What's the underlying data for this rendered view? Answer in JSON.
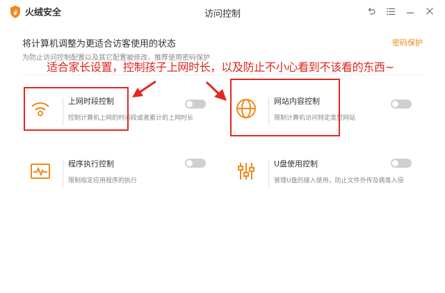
{
  "app": {
    "name": "火绒安全",
    "window_title": "访问控制"
  },
  "window_controls": [
    {
      "name": "back-icon",
      "glyph": "↶"
    },
    {
      "name": "menu-icon",
      "glyph": "☰"
    },
    {
      "name": "minimize-icon",
      "glyph": "—"
    },
    {
      "name": "close-icon",
      "glyph": "✕"
    }
  ],
  "header": {
    "headline": "将计算机调整为更适合访客使用的状态",
    "password_link": "密码保护",
    "subline": "为防止访问控制配置以及其它配置被修改，推荐使用密码保护"
  },
  "annotation": "适合家长设置，控制孩子上网时长，以及防止不小心看到不该看的东西~",
  "features": [
    {
      "title": "上网时段控制",
      "description": "控制计算机上网的时间段或者累计的上网时长",
      "icon": "wifi-icon",
      "enabled": false
    },
    {
      "title": "网站内容控制",
      "description": "限制计算机访问特定类型网站",
      "icon": "globe-icon",
      "enabled": false
    },
    {
      "title": "程序执行控制",
      "description": "限制指定应用程序的执行",
      "icon": "program-monitor-icon",
      "enabled": false
    },
    {
      "title": "U盘使用控制",
      "description": "管理U盘的接入使用，防止文件外传及病毒入侵",
      "icon": "sliders-icon",
      "enabled": false
    }
  ],
  "colors": {
    "accent": "#f08a1c",
    "annotation_red": "#e32620",
    "toggle_off": "#cfcfcf"
  }
}
